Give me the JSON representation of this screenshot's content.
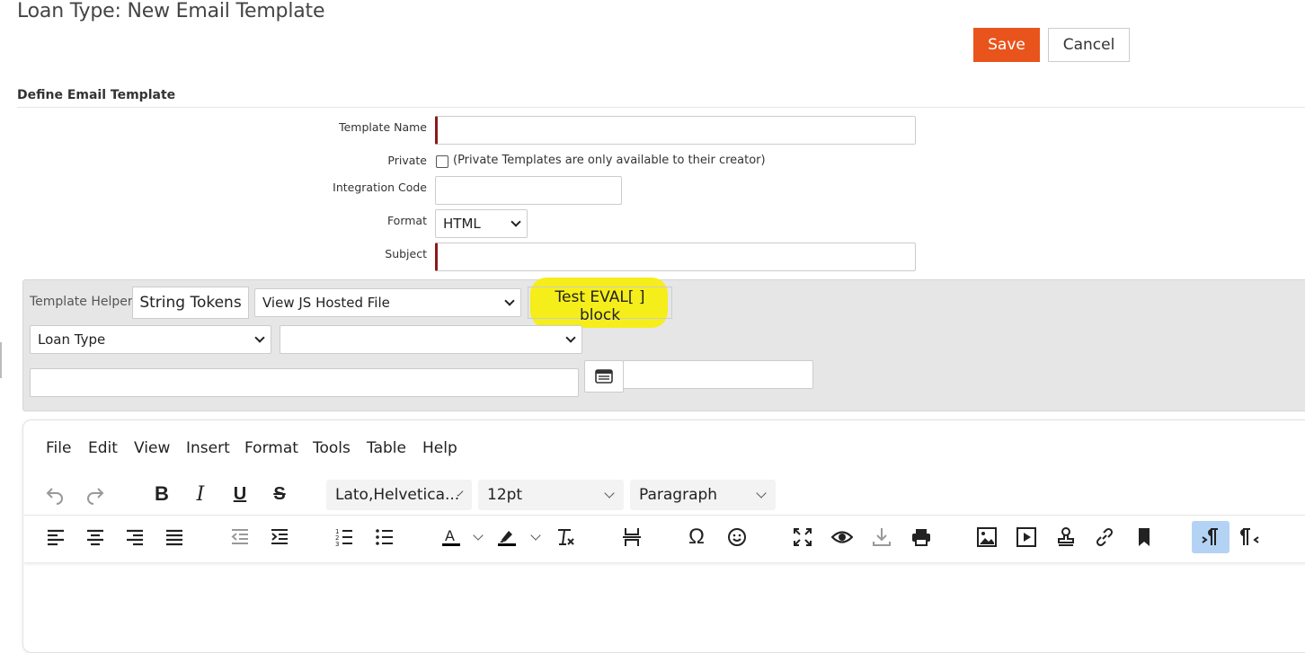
{
  "page": {
    "title": "Loan Type: New Email Template",
    "save_label": "Save",
    "cancel_label": "Cancel",
    "section_title": "Define Email Template"
  },
  "form": {
    "template_name": {
      "label": "Template Name",
      "value": ""
    },
    "private": {
      "label": "Private",
      "checked": false,
      "note": "(Private Templates are only available to their creator)"
    },
    "integration_code": {
      "label": "Integration Code",
      "value": ""
    },
    "format": {
      "label": "Format",
      "selected": "HTML"
    },
    "subject": {
      "label": "Subject",
      "value": ""
    }
  },
  "helper": {
    "label": "Template Helper",
    "string_tokens_label": "String Tokens",
    "js_file_select": "View JS Hosted File",
    "test_eval_label": "Test EVAL[ ] block",
    "object_select": "Loan Type",
    "field_select": "",
    "token_input": "",
    "result_input": ""
  },
  "editor": {
    "menu": [
      "File",
      "Edit",
      "View",
      "Insert",
      "Format",
      "Tools",
      "Table",
      "Help"
    ],
    "font_family": "Lato,Helvetica...",
    "font_size": "12pt",
    "block_format": "Paragraph",
    "icons_row1": [
      "undo-icon",
      "redo-icon",
      "bold-icon",
      "italic-icon",
      "underline-icon",
      "strikethrough-icon"
    ],
    "icons_row2": [
      "align-left-icon",
      "align-center-icon",
      "align-right-icon",
      "align-justify-icon",
      "outdent-icon",
      "indent-icon",
      "numbered-list-icon",
      "bullet-list-icon",
      "text-color-icon",
      "highlight-color-icon",
      "clear-formatting-icon",
      "page-break-icon",
      "special-character-icon",
      "emoji-icon",
      "fullscreen-icon",
      "preview-icon",
      "save-download-icon",
      "print-icon",
      "image-icon",
      "media-icon",
      "stamp-icon",
      "link-icon",
      "bookmark-icon",
      "ltr-icon",
      "rtl-icon"
    ],
    "colors": {
      "text_color_bar": "#000000",
      "highlight_bar": "#000000",
      "active_button_bg": "#b4d3f4"
    }
  },
  "colors": {
    "save_bg": "#e8541c",
    "required_marker": "#8b1a1a",
    "highlight": "#f5ee1a"
  }
}
